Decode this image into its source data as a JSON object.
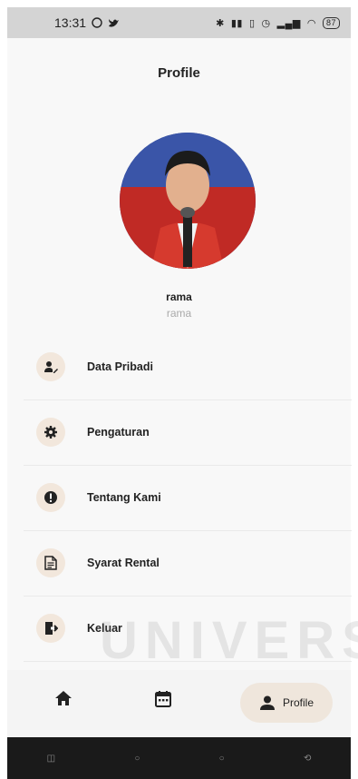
{
  "status": {
    "time": "13:31",
    "battery": "87"
  },
  "header": {
    "title": "Profile"
  },
  "profile": {
    "name": "rama",
    "username": "rama"
  },
  "menu": [
    {
      "label": "Data Pribadi",
      "icon": "user-edit-icon"
    },
    {
      "label": "Pengaturan",
      "icon": "gear-icon"
    },
    {
      "label": "Tentang Kami",
      "icon": "info-icon"
    },
    {
      "label": "Syarat Rental",
      "icon": "document-icon"
    },
    {
      "label": "Keluar",
      "icon": "logout-icon"
    }
  ],
  "bottom_nav": {
    "active_label": "Profile"
  },
  "watermark": "UNIVERS",
  "colors": {
    "accent": "#efe6dc",
    "icon_bg": "#f2e7dc"
  }
}
